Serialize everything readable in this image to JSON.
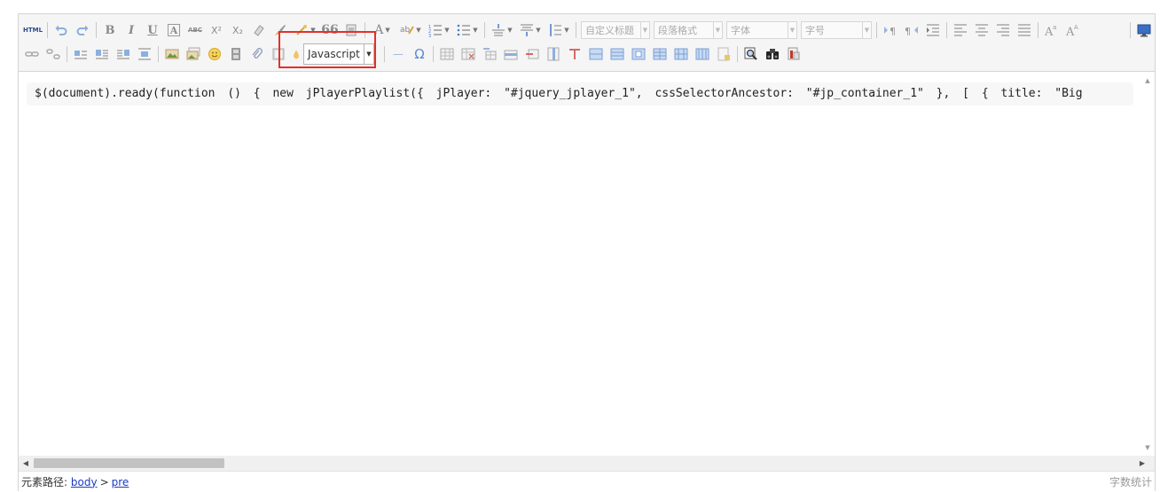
{
  "toolbar": {
    "source_label": "HTML",
    "bold_label": "B",
    "italic_label": "I",
    "underline_label": "U",
    "font_border_label": "A",
    "strikethrough_label": "ABC",
    "superscript_label": "X²",
    "subscript_label": "X₂",
    "blockquote_label": "66",
    "font_color_label": "A",
    "custom_heading_placeholder": "自定义标题",
    "paragraph_format_placeholder": "段落格式",
    "font_family_placeholder": "字体",
    "font_size_placeholder": "字号",
    "code_language": "Javascript",
    "horizontal_rule_label": "—",
    "special_char_label": "Ω"
  },
  "content": {
    "code": "$(document).ready(function () { new jPlayerPlaylist({ jPlayer: \"#jquery_jplayer_1\", cssSelectorAncestor: \"#jp_container_1\" }, [ { title: \"Big"
  },
  "statusbar": {
    "path_label": "元素路径:",
    "path_body": "body",
    "path_separator": ">",
    "path_pre": "pre",
    "word_count_label": "字数统计"
  },
  "colors": {
    "highlight_border": "#e4302b",
    "link": "#1a3bc6"
  }
}
